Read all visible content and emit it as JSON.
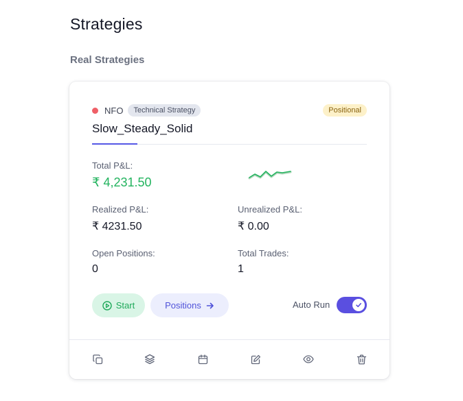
{
  "page": {
    "title": "Strategies",
    "section_title": "Real Strategies"
  },
  "card": {
    "status": "inactive",
    "status_color": "#ef5f67",
    "exchange": "NFO",
    "type_badge": "Technical Strategy",
    "mode_badge": "Positional",
    "name": "Slow_Steady_Solid",
    "total_pnl_label": "Total P&L:",
    "total_pnl_value": "₹ 4,231.50",
    "realized_label": "Realized P&L:",
    "realized_value": "₹ 4231.50",
    "unrealized_label": "Unrealized P&L:",
    "unrealized_value": "₹ 0.00",
    "open_positions_label": "Open Positions:",
    "open_positions_value": "0",
    "total_trades_label": "Total Trades:",
    "total_trades_value": "1",
    "start_button": "Start",
    "positions_button": "Positions",
    "auto_run_label": "Auto Run",
    "auto_run_enabled": true,
    "footer_icons": [
      "copy-icon",
      "layers-icon",
      "calendar-icon",
      "edit-icon",
      "eye-icon",
      "trash-icon"
    ]
  },
  "colors": {
    "accent": "#5457e6",
    "profit": "#22b35e",
    "toggle": "#5a4fe0"
  }
}
